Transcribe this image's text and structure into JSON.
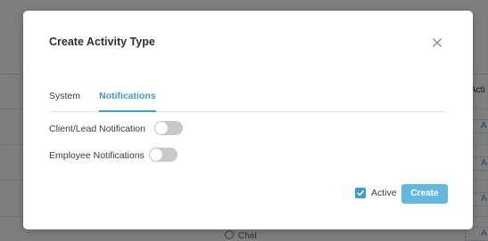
{
  "background": {
    "column_header": "Acti",
    "cell_letter": "A",
    "chat_label": "Chat"
  },
  "modal": {
    "title": "Create Activity Type",
    "tabs": [
      {
        "label": "System",
        "active": false
      },
      {
        "label": "Notifications",
        "active": true
      }
    ],
    "settings": [
      {
        "label": "Client/Lead Notification",
        "enabled": false
      },
      {
        "label": "Employee Notifications",
        "enabled": false
      }
    ],
    "active_checkbox": {
      "label": "Active",
      "checked": true
    },
    "create_button_label": "Create"
  },
  "colors": {
    "accent": "#3b9dcf",
    "button": "#62b8de",
    "toggle_off": "#c9c9c9"
  },
  "icons": [
    "close-icon",
    "check-icon",
    "chat-icon"
  ]
}
